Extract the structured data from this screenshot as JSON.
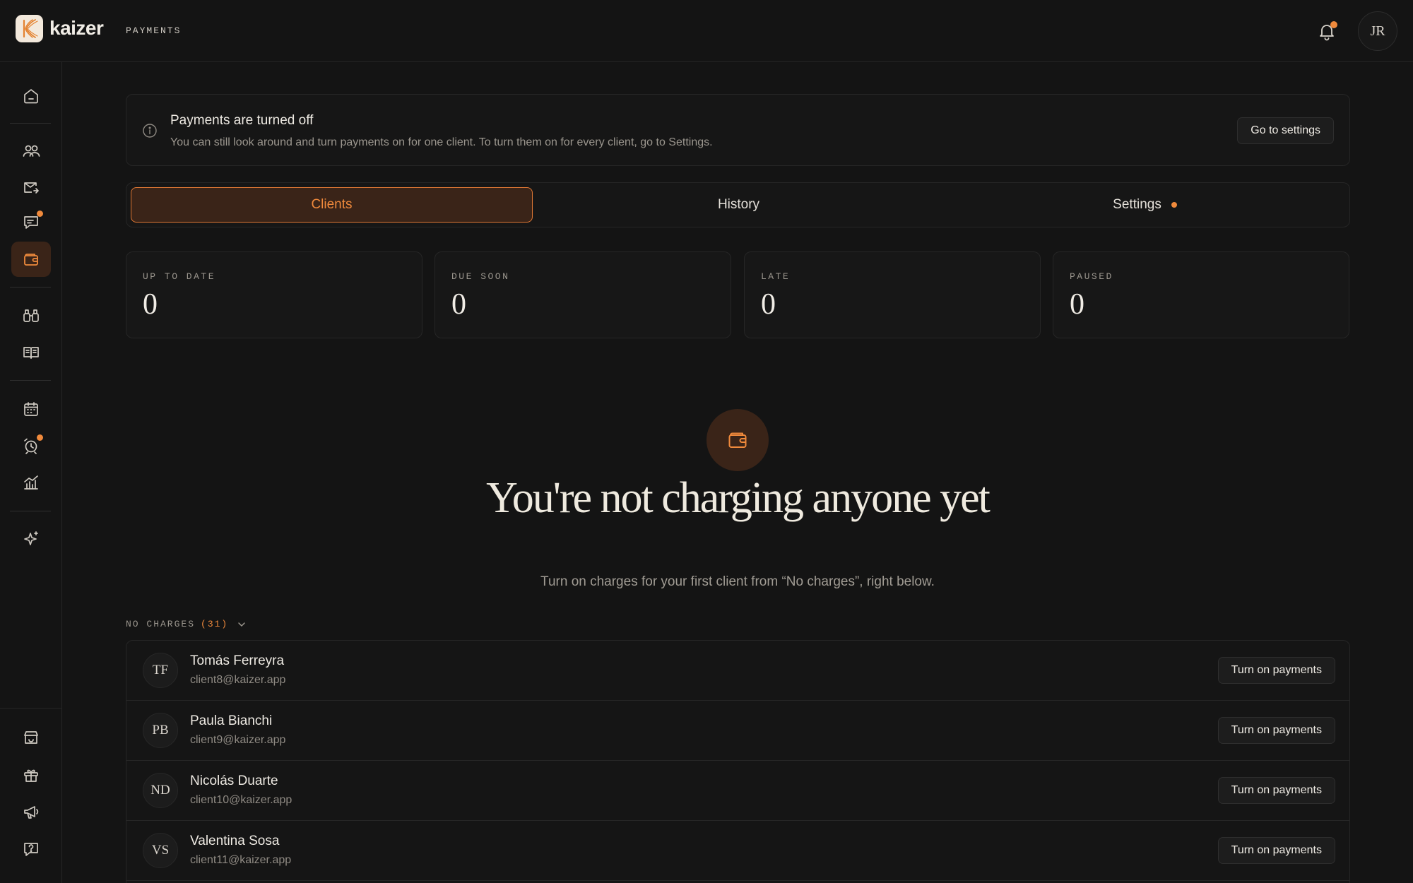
{
  "app": {
    "name": "kaizer",
    "section": "PAYMENTS"
  },
  "user": {
    "initials": "JR"
  },
  "colors": {
    "accent": "#f08a3c",
    "accent_bg": "#3a2418",
    "background": "#141414"
  },
  "sidebar": {
    "items": [
      {
        "icon": "home-icon"
      },
      {
        "icon": "users-icon"
      },
      {
        "icon": "mail-send-icon"
      },
      {
        "icon": "messages-icon",
        "badge": true
      },
      {
        "icon": "wallet-icon",
        "active": true
      },
      {
        "icon": "binoculars-icon"
      },
      {
        "icon": "book-open-icon"
      },
      {
        "icon": "calendar-icon"
      },
      {
        "icon": "alarm-clock-icon",
        "badge": true
      },
      {
        "icon": "analytics-chart-icon"
      },
      {
        "icon": "sparkle-icon"
      },
      {
        "icon": "store-icon"
      },
      {
        "icon": "gift-icon"
      },
      {
        "icon": "megaphone-icon"
      },
      {
        "icon": "help-icon"
      }
    ]
  },
  "banner": {
    "title": "Payments are turned off",
    "text": "You can still look around and turn payments on for one client. To turn them on for every client, go to Settings.",
    "button": "Go to settings"
  },
  "tabs": [
    {
      "label": "Clients",
      "active": true
    },
    {
      "label": "History"
    },
    {
      "label": "Settings",
      "dot": true
    }
  ],
  "stats": [
    {
      "label": "UP TO DATE",
      "value": "0"
    },
    {
      "label": "DUE SOON",
      "value": "0"
    },
    {
      "label": "LATE",
      "value": "0"
    },
    {
      "label": "PAUSED",
      "value": "0"
    }
  ],
  "empty_state": {
    "title": "You're not charging anyone yet",
    "subtitle": "Turn on charges for your first client from “No charges”, right below."
  },
  "list": {
    "header": "NO CHARGES",
    "count": "(31)",
    "rows": [
      {
        "initials": "TF",
        "name": "Tomás Ferreyra",
        "email": "client8@kaizer.app",
        "action": "Turn on payments"
      },
      {
        "initials": "PB",
        "name": "Paula Bianchi",
        "email": "client9@kaizer.app",
        "action": "Turn on payments"
      },
      {
        "initials": "ND",
        "name": "Nicolás Duarte",
        "email": "client10@kaizer.app",
        "action": "Turn on payments"
      },
      {
        "initials": "VS",
        "name": "Valentina Sosa",
        "email": "client11@kaizer.app",
        "action": "Turn on payments"
      }
    ]
  }
}
